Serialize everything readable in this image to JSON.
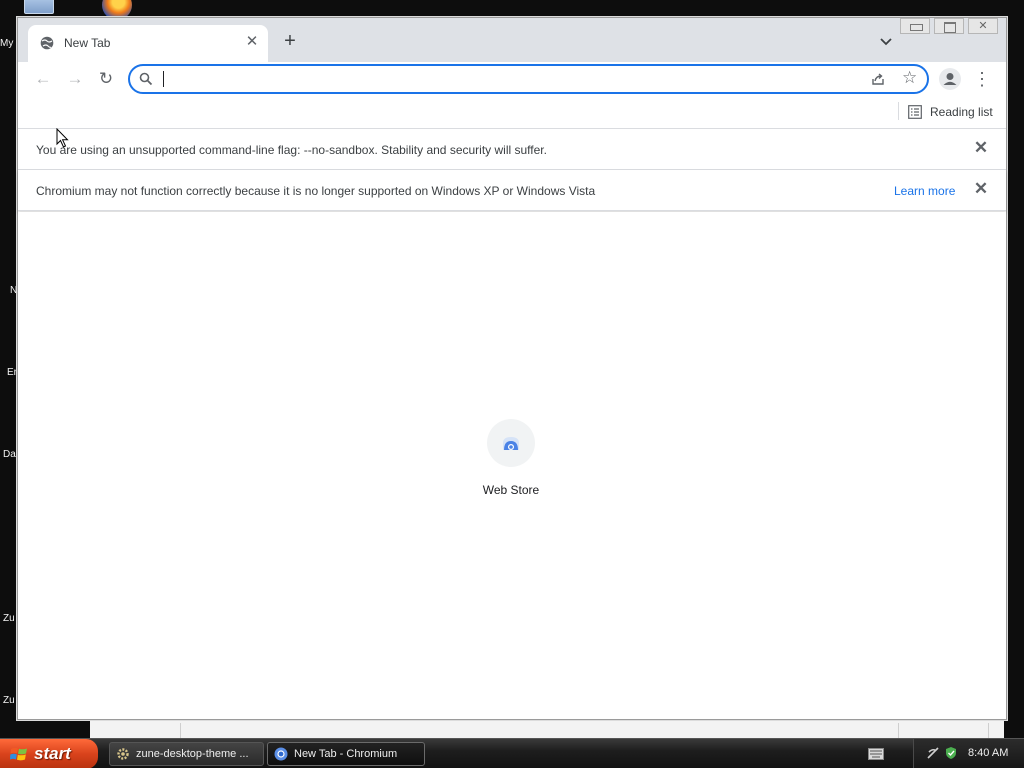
{
  "desktop": {
    "icon_labels": [
      "My Computer",
      "N",
      "Er",
      "Da",
      "Zu",
      "Zu"
    ]
  },
  "browser": {
    "tab": {
      "title": "New Tab"
    },
    "omnibox": {
      "value": "",
      "placeholder": ""
    },
    "bookmarks": {
      "reading_list_label": "Reading list"
    },
    "infobars": [
      {
        "message": "You are using an unsupported command-line flag: --no-sandbox. Stability and security will suffer."
      },
      {
        "message": "Chromium may not function correctly because it is no longer supported on Windows XP or Windows Vista",
        "link": "Learn more"
      }
    ],
    "shortcuts": [
      {
        "label": "Web Store"
      }
    ],
    "colors": {
      "accent": "#1a73e8",
      "tabstrip": "#dee1e6"
    }
  },
  "taskbar": {
    "start_label": "start",
    "tasks": [
      {
        "label": "zune-desktop-theme ...",
        "icon": "gear-icon"
      },
      {
        "label": "New Tab - Chromium",
        "icon": "chromium-icon",
        "active": true
      }
    ],
    "clock": "8:40 AM",
    "colors": {
      "start": "#d9431c"
    }
  }
}
